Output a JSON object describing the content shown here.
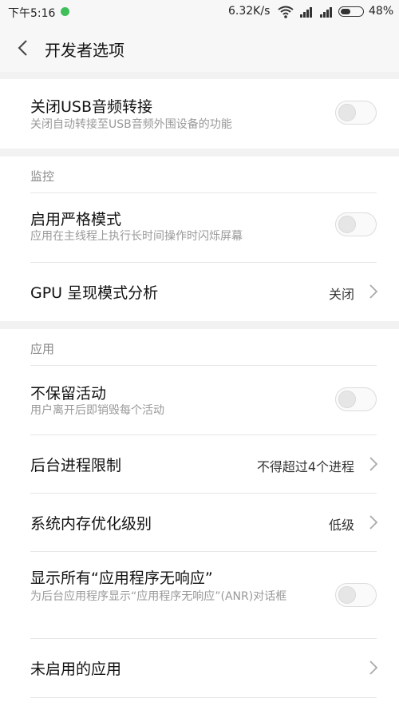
{
  "status_bar": {
    "time": "下午5:16",
    "network_speed": "6.32K/s",
    "battery": "48%",
    "notification_dot_color": "#3fbf5a"
  },
  "header": {
    "title": "开发者选项",
    "back_icon": "chevron-left-icon"
  },
  "sections": {
    "usb": {
      "items": [
        {
          "title": "关闭USB音频转接",
          "subtitle": "关闭自动转接至USB音频外围设备的功能",
          "toggle": false
        }
      ]
    },
    "monitor": {
      "header": "监控",
      "items": [
        {
          "title": "启用严格模式",
          "subtitle": "应用在主线程上执行长时间操作时闪烁屏幕",
          "toggle": false
        },
        {
          "title": "GPU 呈现模式分析",
          "value": "关闭"
        }
      ]
    },
    "apps": {
      "header": "应用",
      "items": [
        {
          "title": "不保留活动",
          "subtitle": "用户离开后即销毁每个活动",
          "toggle": false
        },
        {
          "title": "后台进程限制",
          "value": "不得超过4个进程"
        },
        {
          "title": "系统内存优化级别",
          "value": "低级"
        },
        {
          "title": "显示所有“应用程序无响应”",
          "subtitle": "为后台应用程序显示“应用程序无响应”(ANR)对话框",
          "toggle": false
        },
        {
          "title": "未启用的应用"
        }
      ]
    }
  }
}
